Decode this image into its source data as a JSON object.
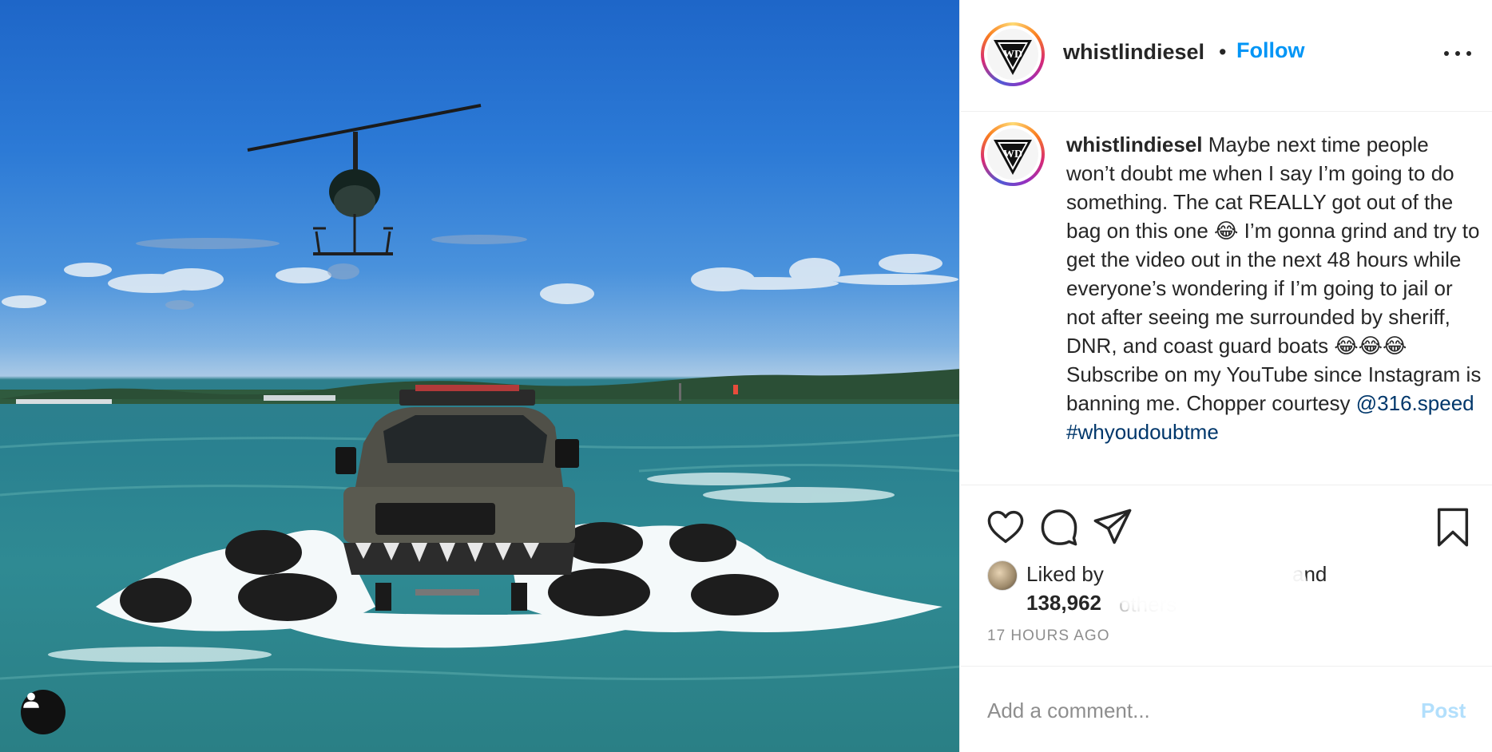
{
  "post": {
    "image_alt": "Lifted truck on giant tires driving through water beneath a helicopter",
    "user_tag_icon": "person-icon"
  },
  "header": {
    "username": "whistlindiesel",
    "separator": "•",
    "follow_label": "Follow",
    "more_icon": "more-horizontal-icon",
    "avatar_text": "WD"
  },
  "caption": {
    "username": "whistlindiesel",
    "text": " Maybe next time people won’t doubt me when I say I’m going to do something. The cat REALLY got out of the bag on this one 😂 I’m gonna grind and try to get the video out in the next 48 hours while everyone’s wondering if I’m going to jail or not after seeing me surrounded by sheriff, DNR, and coast guard boats 😂😂😂 Subscribe on my YouTube since Instagram is banning me. Chopper courtesy ",
    "mention": "@316.speed",
    "space": " ",
    "hashtag": "#whyoudoubtme"
  },
  "actions": {
    "like_icon": "heart-icon",
    "comment_icon": "comment-icon",
    "share_icon": "share-icon",
    "save_icon": "bookmark-icon"
  },
  "likes": {
    "liked_by_prefix": "Liked by",
    "liked_by_suffix": "and",
    "count": "138,962",
    "others": "others"
  },
  "timestamp": "17 HOURS AGO",
  "comment": {
    "placeholder": "Add a comment...",
    "post_label": "Post"
  },
  "colors": {
    "accent": "#0095f6",
    "link": "#00376b",
    "muted": "#8e8e8e",
    "post_disabled": "#b2dffc"
  }
}
